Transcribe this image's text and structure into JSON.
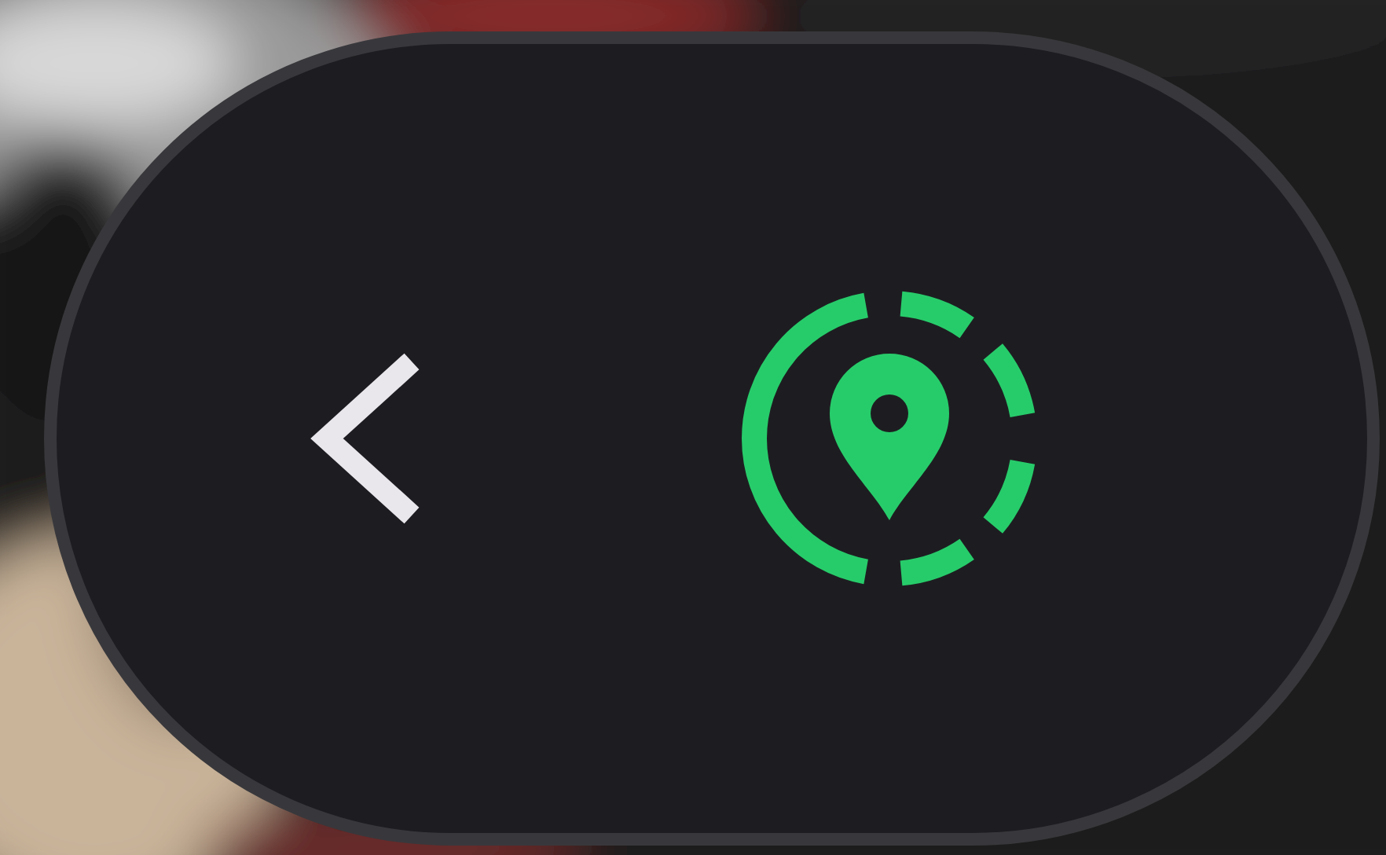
{
  "control": {
    "buttons": [
      {
        "kind": "back"
      },
      {
        "kind": "location"
      }
    ]
  }
}
